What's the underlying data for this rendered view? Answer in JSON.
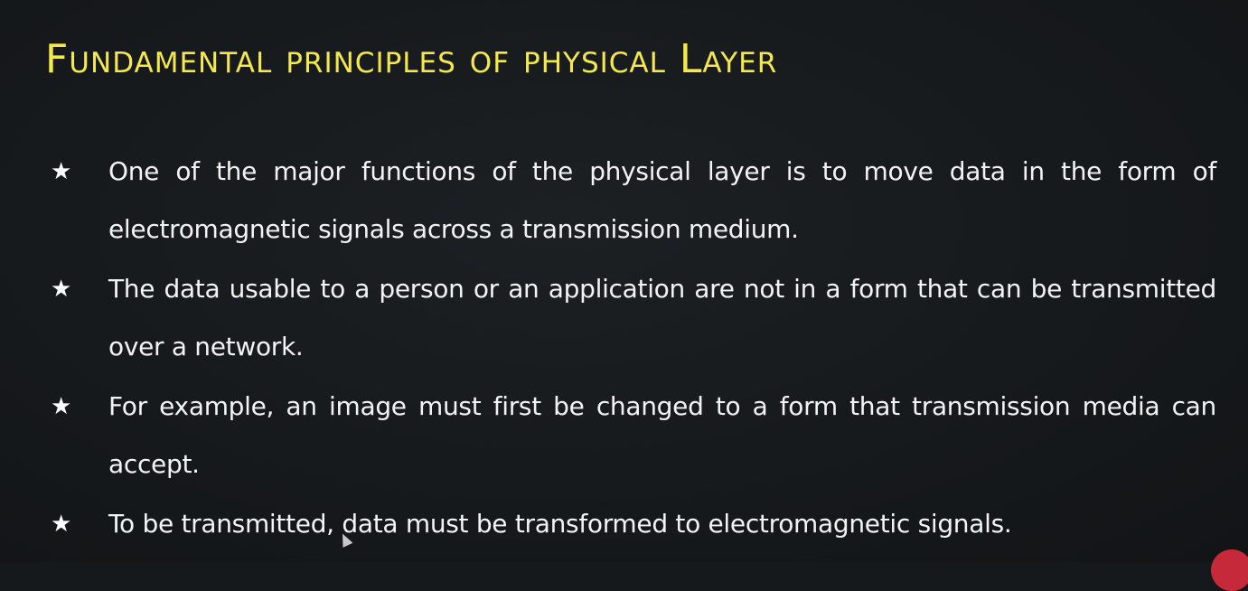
{
  "slide": {
    "title": "Fundamental principles of physical Layer",
    "bullet_icon": "★",
    "bullets": [
      "One of the major functions of the physical layer is to move data in the form of electromagnetic signals across a transmission medium.",
      "The data usable to a person or an application are not in a form that can be transmitted over a network.",
      "For example, an image must first be changed to a form that transmission media can accept.",
      "To be transmitted, data must be transformed to electromagnetic signals."
    ]
  },
  "colors": {
    "background": "#16191b",
    "title": "#f4e84a",
    "text": "#f3f3f3",
    "badge": "#c62a3a"
  },
  "icons": {
    "bullet": "star-icon",
    "pointer": "mouse-cursor-icon"
  }
}
